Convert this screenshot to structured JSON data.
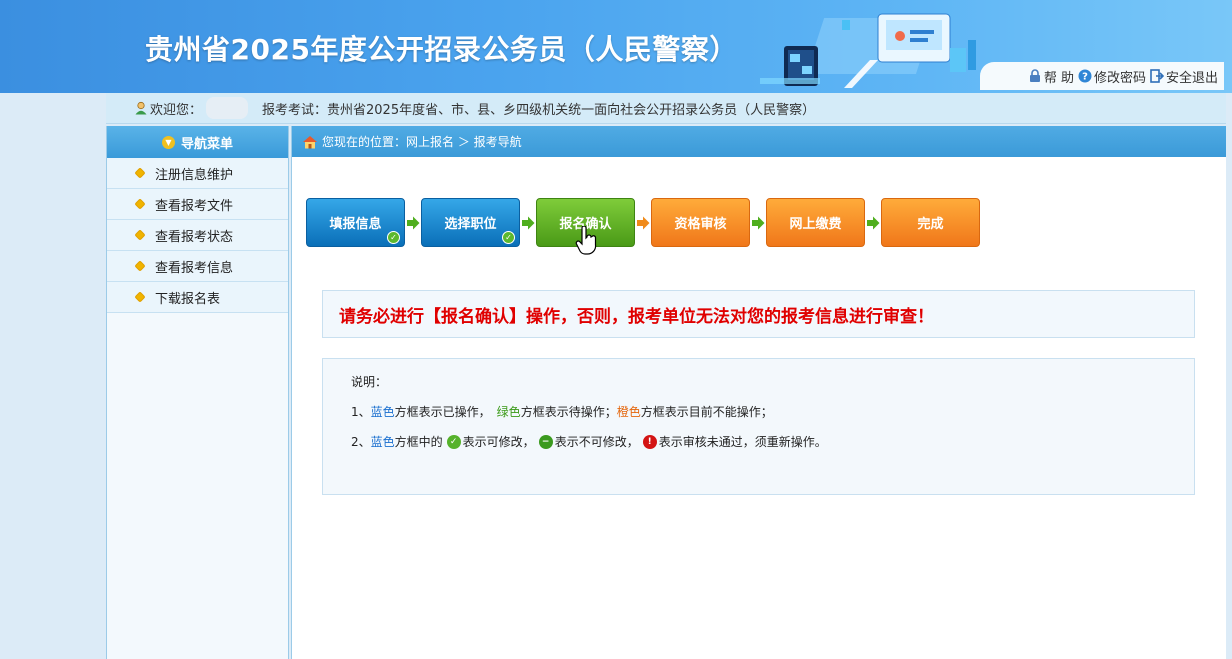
{
  "header": {
    "title": "贵州省2025年度公开招录公务员（人民警察）",
    "toolbar": [
      {
        "label": "帮 助",
        "icon": "lock-icon"
      },
      {
        "label": "修改密码",
        "icon": "help-icon"
      },
      {
        "label": "安全退出",
        "icon": "exit-icon"
      }
    ]
  },
  "welcome": {
    "label": "欢迎您：",
    "exam_text": "报考考试：贵州省2025年度省、市、县、乡四级机关统一面向社会公开招录公务员（人民警察）"
  },
  "sidebar": {
    "title": "导航菜单",
    "items": [
      {
        "label": "注册信息维护"
      },
      {
        "label": "查看报考文件"
      },
      {
        "label": "查看报考状态"
      },
      {
        "label": "查看报考信息"
      },
      {
        "label": "下载报名表"
      }
    ]
  },
  "breadcrumb": {
    "text": "您现在的位置：网上报名 ＞ 报考导航"
  },
  "steps": [
    {
      "label": "填报信息",
      "status": "blue",
      "done": true
    },
    {
      "label": "选择职位",
      "status": "blue",
      "done": true
    },
    {
      "label": "报名确认",
      "status": "green",
      "done": false
    },
    {
      "label": "资格审核",
      "status": "orange",
      "done": false
    },
    {
      "label": "网上缴费",
      "status": "orange",
      "done": false
    },
    {
      "label": "完成",
      "status": "orange",
      "done": false
    }
  ],
  "warning": "请务必进行【报名确认】操作，否则，报考单位无法对您的报考信息进行审查！",
  "notes": {
    "title": "说明：",
    "line1": {
      "prefix": "1、",
      "blue": "蓝色",
      "t1": "方框表示已操作，",
      "green": "绿色",
      "t2": "方框表示待操作；",
      "orange": "橙色",
      "t3": "方框表示目前不能操作；"
    },
    "line2": {
      "prefix": "2、",
      "blue": "蓝色",
      "t1": "方框中的",
      "t2": "表示可修改，",
      "t3": "表示不可修改，",
      "t4": "表示审核未通过，须重新操作。"
    }
  },
  "colors": {
    "blue": "#1a6fcf",
    "green": "#3a9a17",
    "orange": "#e4670e",
    "warning": "#e00000"
  }
}
